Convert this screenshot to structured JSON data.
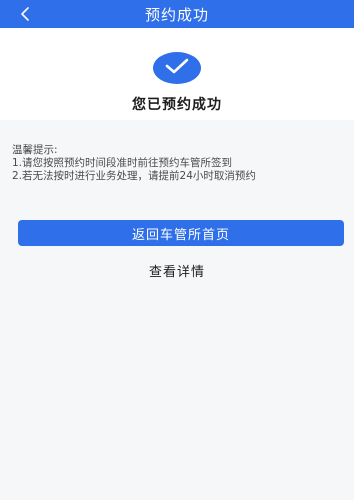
{
  "header": {
    "title": "预约成功",
    "back_icon": "chevron-left-icon"
  },
  "success": {
    "icon": "check-icon",
    "message": "您已预约成功"
  },
  "tips": {
    "heading": "温馨提示:",
    "items": [
      "1.请您按照预约时间段准时前往预约车管所签到",
      "2.若无法按时进行业务处理，请提前24小时取消预约"
    ]
  },
  "actions": {
    "return_label": "返回车管所首页",
    "detail_label": "查看详情"
  },
  "colors": {
    "primary": "#2f6fea",
    "background": "#f6f7f9"
  }
}
